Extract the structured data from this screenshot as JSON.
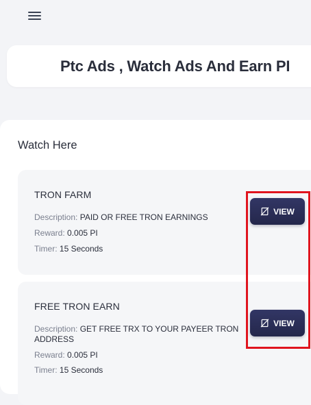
{
  "header": {
    "menu_icon": "hamburger-menu-icon",
    "title": "Ptc Ads , Watch Ads And Earn PI"
  },
  "section": {
    "heading": "Watch Here"
  },
  "ads": [
    {
      "title": "TRON FARM",
      "description_label": "Description:",
      "description": "PAID OR FREE TRON EARNINGS",
      "reward_label": "Reward:",
      "reward": "0.005 PI",
      "timer_label": "Timer:",
      "timer": "15 Seconds",
      "button_label": "VIEW",
      "button_icon": "eye-slash-icon"
    },
    {
      "title": "FREE TRON EARN",
      "description_label": "Description:",
      "description": "GET FREE TRX TO YOUR PAYEER TRON ADDRESS",
      "reward_label": "Reward:",
      "reward": "0.005 PI",
      "timer_label": "Timer:",
      "timer": "15 Seconds",
      "button_label": "VIEW",
      "button_icon": "eye-slash-icon"
    }
  ],
  "colors": {
    "background": "#f3f4f7",
    "card": "#ffffff",
    "ad_card": "#f5f6f8",
    "button": "#2b2f58",
    "label_text": "#7a7f8e",
    "highlight": "#e0141e"
  }
}
